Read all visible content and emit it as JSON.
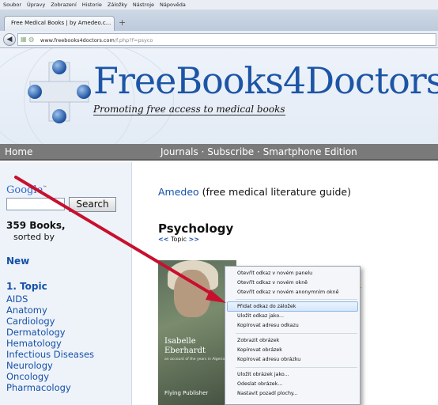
{
  "browser": {
    "menu": [
      "Soubor",
      "Úpravy",
      "Zobrazení",
      "Historie",
      "Záložky",
      "Nástroje",
      "Nápověda"
    ],
    "tab_title": "Free Medical Books | by Amedeo.c...",
    "new_tab": "+",
    "url_domain": "www.freebooks4doctors.com",
    "url_path": "/f.php?f=psyco"
  },
  "banner": {
    "brand": "FreeBooks4Doctors",
    "brand_bang": "!",
    "tagline": "Promoting free access to medical books"
  },
  "sitenav": {
    "home": "Home",
    "links": "Journals · Subscribe · Smartphone Edition"
  },
  "sidebar": {
    "google": "Google",
    "google_tm": "™",
    "search_button": "Search",
    "count": "359 Books,",
    "sorted_by": "sorted by",
    "new": "New",
    "topic_heading": "1. Topic",
    "categories": [
      "AIDS",
      "Anatomy",
      "Cardiology",
      "Dermatology",
      "Hematology",
      "Infectious Diseases",
      "Neurology",
      "Oncology",
      "Pharmacology"
    ]
  },
  "main": {
    "amedeo_link": "Amedeo",
    "amedeo_rest": " (free medical literature guide)",
    "section_title": "Psychology",
    "prev": "<<",
    "topic": " Topic ",
    "next": ">>",
    "stars": "★",
    "cover": {
      "title_line1": "Isabelle",
      "title_line2": "Eberhardt",
      "subtitle": "an account of the years in Algeria",
      "publisher": "Flying Publisher"
    }
  },
  "context_menu": {
    "items": [
      "Otevřít odkaz v novém panelu",
      "Otevřít odkaz v novém okně",
      "Otevřít odkaz v novém anonymním okně",
      "Přidat odkaz do záložek",
      "Uložit odkaz jako...",
      "Kopírovat adresu odkazu",
      "Zobrazit obrázek",
      "Kopírovat obrázek",
      "Kopírovat adresu obrázku",
      "Uložit obrázek jako...",
      "Odeslat obrázek...",
      "Nastavit pozadí plochy..."
    ],
    "highlighted": "Kopírovat adresu odkazu"
  },
  "colors": {
    "brand_blue": "#1d55a6",
    "link_blue": "#1550a8",
    "nav_gray": "#7a7a7a",
    "arrow_red": "#c8102e",
    "highlight": "#d4e6fb"
  }
}
